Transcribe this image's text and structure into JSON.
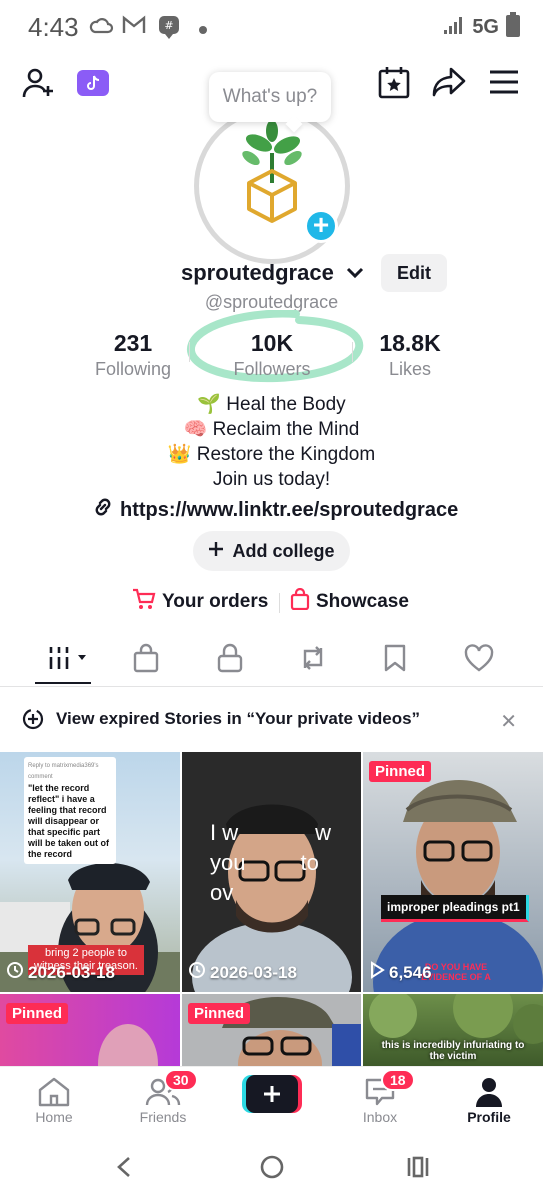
{
  "status_bar": {
    "time": "4:43",
    "network": "5G"
  },
  "profile": {
    "bubble_text": "What's up?",
    "display_name": "sproutedgrace",
    "edit_label": "Edit",
    "handle": "@sproutedgrace",
    "stats": [
      {
        "value": "231",
        "label": "Following"
      },
      {
        "value": "10K",
        "label": "Followers"
      },
      {
        "value": "18.8K",
        "label": "Likes"
      }
    ],
    "bio": [
      "🌱 Heal the Body",
      "🧠 Reclaim the Mind",
      "👑 Restore the Kingdom",
      "Join us today!"
    ],
    "link": "https://www.linktr.ee/sproutedgrace",
    "add_college_label": "Add college",
    "orders_label": "Your orders",
    "showcase_label": "Showcase"
  },
  "stories_banner": {
    "text": "View expired Stories in “Your private videos”"
  },
  "grid": [
    {
      "caption": "\"let the record reflect\" i have a feeling that record will disappear or that specific part will be taken out of the record",
      "reply_header": "Reply to matrixmedia369's comment",
      "bottom_caption": "bring 2 people to witness their treason.",
      "meta": "2026-03-18"
    },
    {
      "overlay": "I w…  w you…  to ov…",
      "meta": "2026-03-18"
    },
    {
      "pinned": "Pinned",
      "caption": "improper pleadings pt1",
      "meta": "6,546",
      "subtitle": "DO YOU HAVE EVIDENCE OF A"
    },
    {
      "pinned": "Pinned"
    },
    {
      "pinned": "Pinned"
    },
    {
      "subtitle": "this is incredibly infuriating to the victim"
    }
  ],
  "bottom_nav": {
    "home": "Home",
    "friends": "Friends",
    "friends_badge": "30",
    "inbox": "Inbox",
    "inbox_badge": "18",
    "profile": "Profile"
  },
  "colors": {
    "accent": "#fe2c55",
    "cyan": "#2bd9e3",
    "highlight": "#a8e6c9"
  }
}
